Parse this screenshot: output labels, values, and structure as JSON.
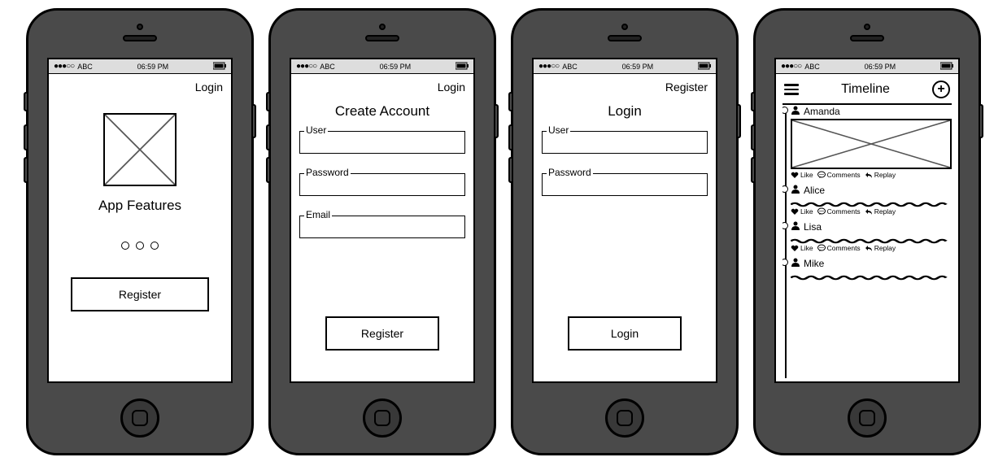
{
  "status_bar": {
    "carrier": "ABC",
    "time": "06:59 PM",
    "signal": "●●●○○"
  },
  "screen1": {
    "top_link": "Login",
    "title": "App Features",
    "button": "Register"
  },
  "screen2": {
    "top_link": "Login",
    "title": "Create Account",
    "fields": {
      "user": "User",
      "password": "Password",
      "email": "Email"
    },
    "button": "Register"
  },
  "screen3": {
    "top_link": "Register",
    "title": "Login",
    "fields": {
      "user": "User",
      "password": "Password"
    },
    "button": "Login"
  },
  "screen4": {
    "title": "Timeline",
    "action_labels": {
      "like": "Like",
      "comments": "Comments",
      "replay": "Replay"
    },
    "posts": [
      {
        "user": "Amanda"
      },
      {
        "user": "Alice"
      },
      {
        "user": "Lisa"
      },
      {
        "user": "Mike"
      }
    ]
  }
}
